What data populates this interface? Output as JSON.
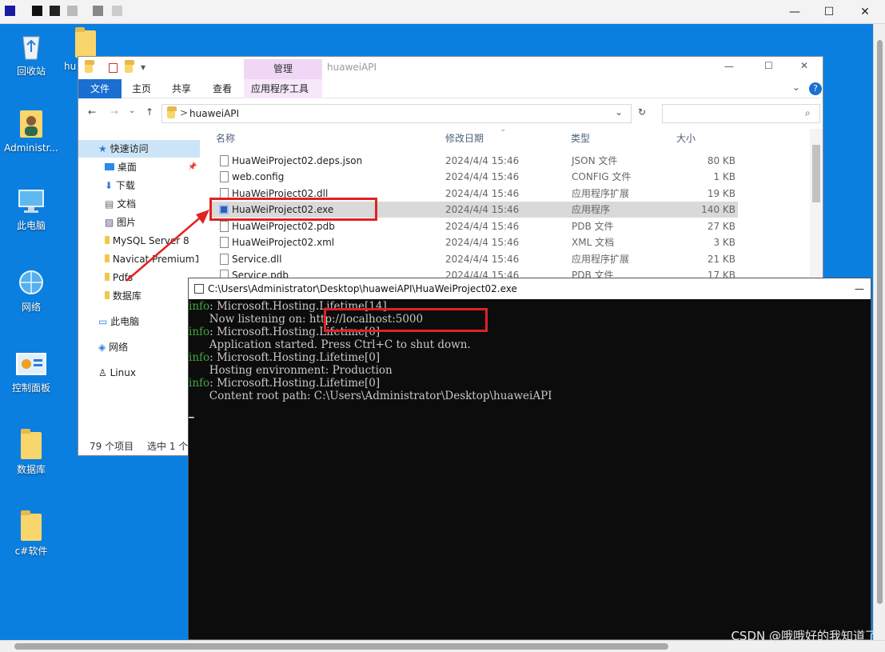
{
  "outer_window": {
    "controls": {
      "minimize": "—",
      "maximize": "☐",
      "close": "✕"
    }
  },
  "desktop": {
    "icons": [
      {
        "label": "回收站"
      },
      {
        "label": "hu"
      },
      {
        "label": "Administr..."
      },
      {
        "label": "此电脑"
      },
      {
        "label": "网络"
      },
      {
        "label": "控制面板"
      },
      {
        "label": "数据库"
      },
      {
        "label": "c#软件"
      }
    ]
  },
  "explorer": {
    "manage_tab": "管理",
    "title": "huaweiAPI",
    "ribbon_tabs": [
      "文件",
      "主页",
      "共享",
      "查看",
      "应用程序工具"
    ],
    "address": {
      "path_segment": "huaweiAPI",
      "separator": ">"
    },
    "nav_items": [
      "快速访问",
      "桌面",
      "下载",
      "文档",
      "图片",
      "MySQL Server 8",
      "Navicat Premium1",
      "Pdfs",
      "数据库",
      "此电脑",
      "网络",
      "Linux"
    ],
    "columns": {
      "name": "名称",
      "date": "修改日期",
      "type": "类型",
      "size": "大小"
    },
    "files": [
      {
        "name": "HuaWeiProject02.deps.json",
        "date": "2024/4/4 15:46",
        "type": "JSON 文件",
        "size": "80 KB"
      },
      {
        "name": "web.config",
        "date": "2024/4/4 15:46",
        "type": "CONFIG 文件",
        "size": "1 KB"
      },
      {
        "name": "HuaWeiProject02.dll",
        "date": "2024/4/4 15:46",
        "type": "应用程序扩展",
        "size": "19 KB"
      },
      {
        "name": "HuaWeiProject02.exe",
        "date": "2024/4/4 15:46",
        "type": "应用程序",
        "size": "140 KB"
      },
      {
        "name": "HuaWeiProject02.pdb",
        "date": "2024/4/4 15:46",
        "type": "PDB 文件",
        "size": "27 KB"
      },
      {
        "name": "HuaWeiProject02.xml",
        "date": "2024/4/4 15:46",
        "type": "XML 文档",
        "size": "3 KB"
      },
      {
        "name": "Service.dll",
        "date": "2024/4/4 15:46",
        "type": "应用程序扩展",
        "size": "21 KB"
      },
      {
        "name": "Service.pdb",
        "date": "2024/4/4 15:46",
        "type": "PDB 文件",
        "size": "17 KB"
      }
    ],
    "status": {
      "count": "79 个项目",
      "selected": "选中 1 个"
    }
  },
  "console": {
    "title": "C:\\Users\\Administrator\\Desktop\\huaweiAPI\\HuaWeiProject02.exe",
    "minimize": "—",
    "lines": [
      {
        "prefix": "info",
        "text": ": Microsoft.Hosting.Lifetime[14]"
      },
      {
        "prefix": "",
        "text": "      Now listening on: http://localhost:5000"
      },
      {
        "prefix": "info",
        "text": ": Microsoft.Hosting.Lifetime[0]"
      },
      {
        "prefix": "",
        "text": "      Application started. Press Ctrl+C to shut down."
      },
      {
        "prefix": "info",
        "text": ": Microsoft.Hosting.Lifetime[0]"
      },
      {
        "prefix": "",
        "text": "      Hosting environment: Production"
      },
      {
        "prefix": "info",
        "text": ": Microsoft.Hosting.Lifetime[0]"
      },
      {
        "prefix": "",
        "text": "      Content root path: C:\\Users\\Administrator\\Desktop\\huaweiAPI"
      }
    ],
    "cursor": "_"
  },
  "watermark": "CSDN @哦哦好的我知道了",
  "colors": {
    "desktop": "#0b7fe0",
    "highlight": "#e02222",
    "console_info": "#3fa93f",
    "file_tab": "#1a6fd1"
  }
}
